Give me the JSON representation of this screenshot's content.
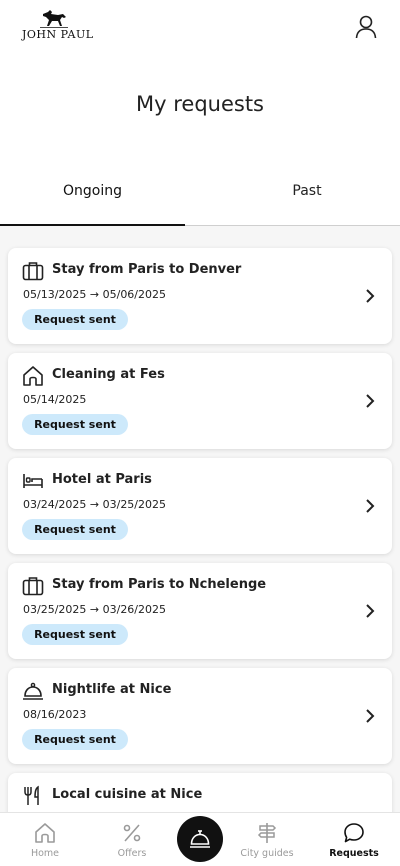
{
  "brand": {
    "logo_text": "JOHN PAUL"
  },
  "header": {
    "title": "My requests"
  },
  "tabs": [
    {
      "label": "Ongoing",
      "active": true
    },
    {
      "label": "Past",
      "active": false
    }
  ],
  "requests": [
    {
      "icon": "suitcase-icon",
      "title": "Stay from Paris to Denver",
      "dates": "05/13/2025 → 05/06/2025",
      "status": "Request sent"
    },
    {
      "icon": "house-icon",
      "title": "Cleaning at Fes",
      "dates": "05/14/2025",
      "status": "Request sent"
    },
    {
      "icon": "bed-icon",
      "title": "Hotel at Paris",
      "dates": "03/24/2025 → 03/25/2025",
      "status": "Request sent"
    },
    {
      "icon": "suitcase-icon",
      "title": "Stay from Paris to Nchelenge",
      "dates": "03/25/2025 → 03/26/2025",
      "status": "Request sent"
    },
    {
      "icon": "cloche-icon",
      "title": "Nightlife at Nice",
      "dates": "08/16/2023",
      "status": "Request sent"
    },
    {
      "icon": "fork-knife-icon",
      "title": "Local cuisine at Nice",
      "dates": "",
      "status": ""
    }
  ],
  "bottom_nav": {
    "home": "Home",
    "offers": "Offers",
    "city_guides": "City guides",
    "requests": "Requests",
    "active": "requests"
  },
  "colors": {
    "badge_bg": "#cde9fb",
    "accent": "#111111",
    "list_bg": "#f6f6f6"
  }
}
